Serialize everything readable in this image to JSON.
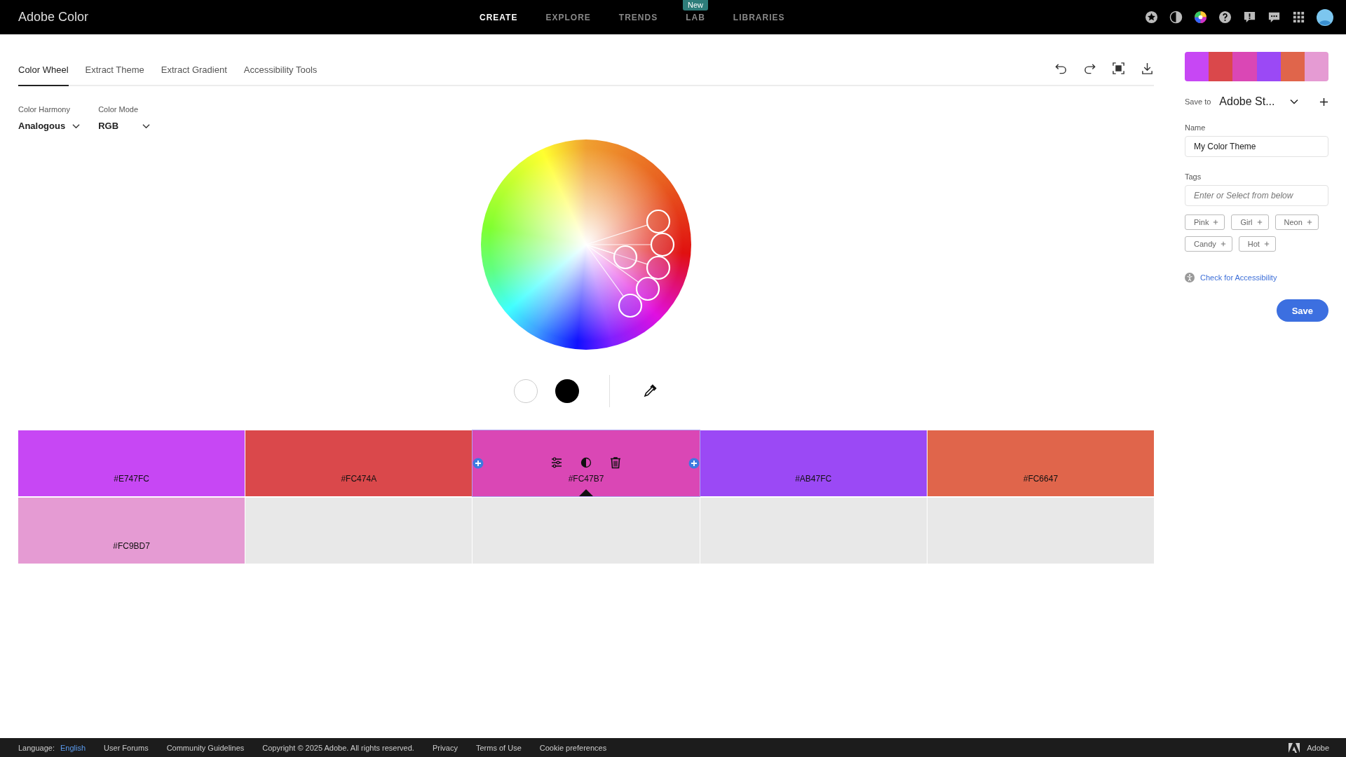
{
  "app": {
    "title": "Adobe Color"
  },
  "nav": [
    {
      "label": "CREATE",
      "selected": true
    },
    {
      "label": "EXPLORE",
      "selected": false
    },
    {
      "label": "TRENDS",
      "selected": false
    },
    {
      "label": "LAB",
      "selected": false,
      "badge": "New"
    },
    {
      "label": "LIBRARIES",
      "selected": false
    }
  ],
  "tabs": [
    {
      "label": "Color Wheel",
      "selected": true
    },
    {
      "label": "Extract Theme",
      "selected": false
    },
    {
      "label": "Extract Gradient",
      "selected": false
    },
    {
      "label": "Accessibility Tools",
      "selected": false
    }
  ],
  "harmony": {
    "label": "Color Harmony",
    "value": "Analogous"
  },
  "mode": {
    "label": "Color Mode",
    "value": "RGB"
  },
  "swatches": [
    {
      "hex": "#E747FC",
      "color": "#c747f4",
      "selected": false
    },
    {
      "hex": "#FC474A",
      "color": "#da484b",
      "selected": false
    },
    {
      "hex": "#FC47B7",
      "color": "#da47b5",
      "selected": true
    },
    {
      "hex": "#AB47FC",
      "color": "#9b49f5",
      "selected": false
    },
    {
      "hex": "#FC6647",
      "color": "#e0654b",
      "selected": false
    },
    {
      "hex": "#FC9BD7",
      "color": "#e59bd3",
      "selected": false
    }
  ],
  "panel": {
    "save_to_label": "Save to",
    "save_to_value": "Adobe St...",
    "name_label": "Name",
    "name_value": "My Color Theme",
    "tags_label": "Tags",
    "tags_placeholder": "Enter or Select from below",
    "tags": [
      "Pink",
      "Girl",
      "Neon",
      "Candy",
      "Hot"
    ],
    "accessibility_link": "Check for Accessibility",
    "save_button": "Save"
  },
  "footer": {
    "language_label": "Language:",
    "language": "English",
    "links": [
      "User Forums",
      "Community Guidelines",
      "Copyright © 2025 Adobe. All rights reserved.",
      "Privacy",
      "Terms of Use",
      "Cookie preferences"
    ],
    "brand": "Adobe"
  }
}
